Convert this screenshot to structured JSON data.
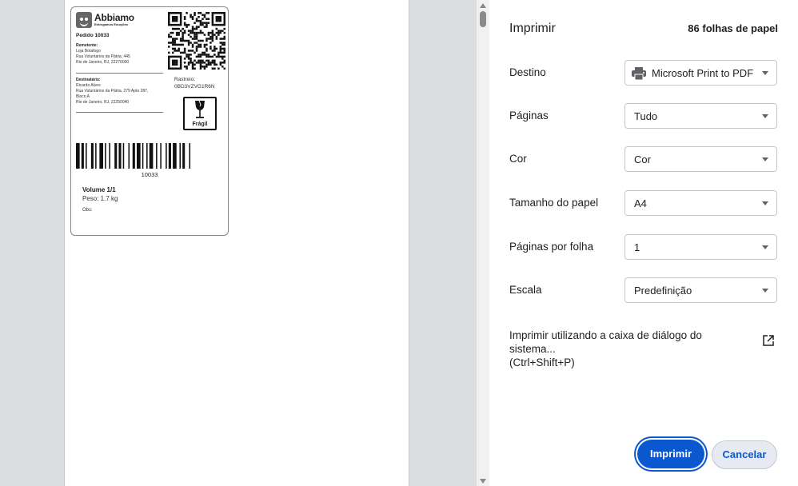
{
  "dialog": {
    "title": "Imprimir",
    "sheets": "86 folhas de papel",
    "settings": [
      {
        "label": "Destino",
        "value": "Microsoft Print to PDF",
        "icon": "printer-icon"
      },
      {
        "label": "Páginas",
        "value": "Tudo"
      },
      {
        "label": "Cor",
        "value": "Cor"
      },
      {
        "label": "Tamanho do papel",
        "value": "A4"
      },
      {
        "label": "Páginas por folha",
        "value": "1"
      },
      {
        "label": "Escala",
        "value": "Predefinição"
      }
    ],
    "system_dialog_line1": "Imprimir utilizando a caixa de diálogo do sistema...",
    "system_dialog_line2": "(Ctrl+Shift+P)",
    "print_button": "Imprimir",
    "cancel_button": "Cancelar",
    "accent": "#0b57d0"
  },
  "label": {
    "brand": "Abbiamo",
    "brand_tagline": "Entregamos Emoções",
    "order": "Pedido 10033",
    "sender_heading": "Remetente:",
    "sender_lines": [
      "Loja Botafogo",
      "Rua Voluntários da Pátria, 445",
      "Rio de Janeiro, RJ, 22270000"
    ],
    "recipient_heading": "Destinatário:",
    "recipient_lines": [
      "Ricardo Alves",
      "Rua Voluntários da Pátria, 279 Apto 287,",
      "Bloco A",
      "Rio de Janeiro, RJ, 22250040"
    ],
    "tracking_label": "Rastreio:",
    "tracking_code": "0BD3VZVG1R6N",
    "fragile": "Frágil",
    "barcode_number": "10033",
    "volume": "Volume 1/1",
    "weight": "Peso: 1.7 kg",
    "obs": "Obs:"
  }
}
